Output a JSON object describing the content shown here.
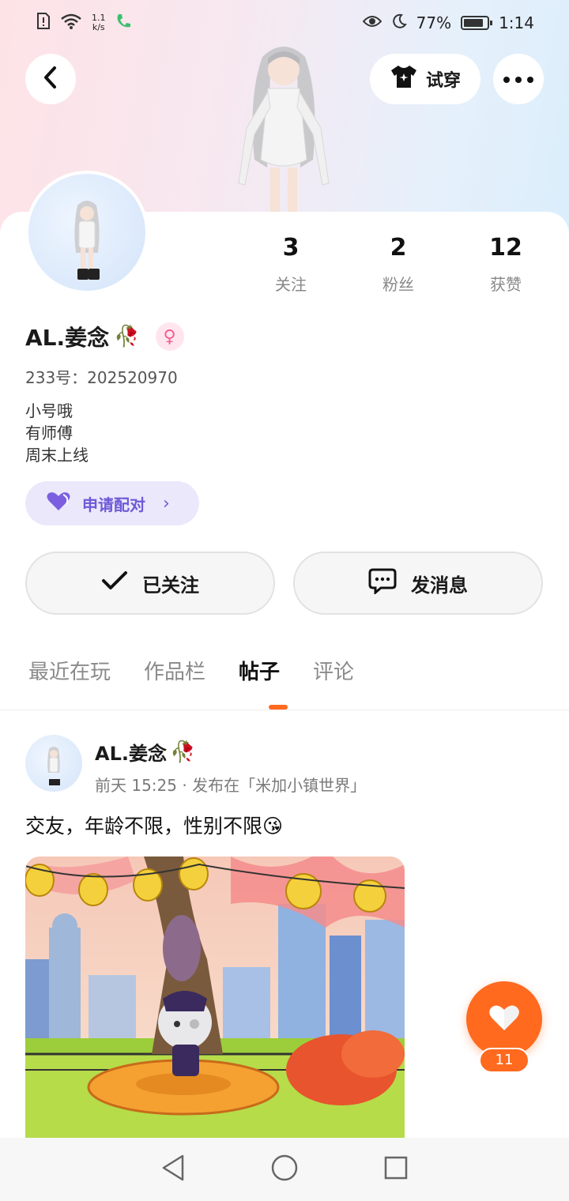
{
  "status_bar": {
    "network_speed_value": "1.1",
    "network_speed_unit": "k/s",
    "battery": "77%",
    "time": "1:14"
  },
  "header": {
    "tryon_label": "试穿"
  },
  "stats": [
    {
      "value": "3",
      "label": "关注"
    },
    {
      "value": "2",
      "label": "粉丝"
    },
    {
      "value": "12",
      "label": "获赞"
    }
  ],
  "profile": {
    "name": "AL.姜念",
    "id_line": "233号：202520970",
    "bio": [
      "小号哦",
      "有师傅",
      "周末上线"
    ],
    "pair_label": "申请配对"
  },
  "actions": {
    "follow_label": "已关注",
    "message_label": "发消息"
  },
  "tabs": [
    {
      "label": "最近在玩",
      "active": false
    },
    {
      "label": "作品栏",
      "active": false
    },
    {
      "label": "帖子",
      "active": true
    },
    {
      "label": "评论",
      "active": false
    }
  ],
  "post": {
    "author": "AL.姜念",
    "meta": "前天 15:25 · 发布在「米加小镇世界」",
    "text": "交友，年龄不限，性别不限😘"
  },
  "like": {
    "count": "11"
  },
  "colors": {
    "accent": "#ff6a1f",
    "pair_purple": "#6f5ad8",
    "pair_bg": "#ebe8fb"
  }
}
